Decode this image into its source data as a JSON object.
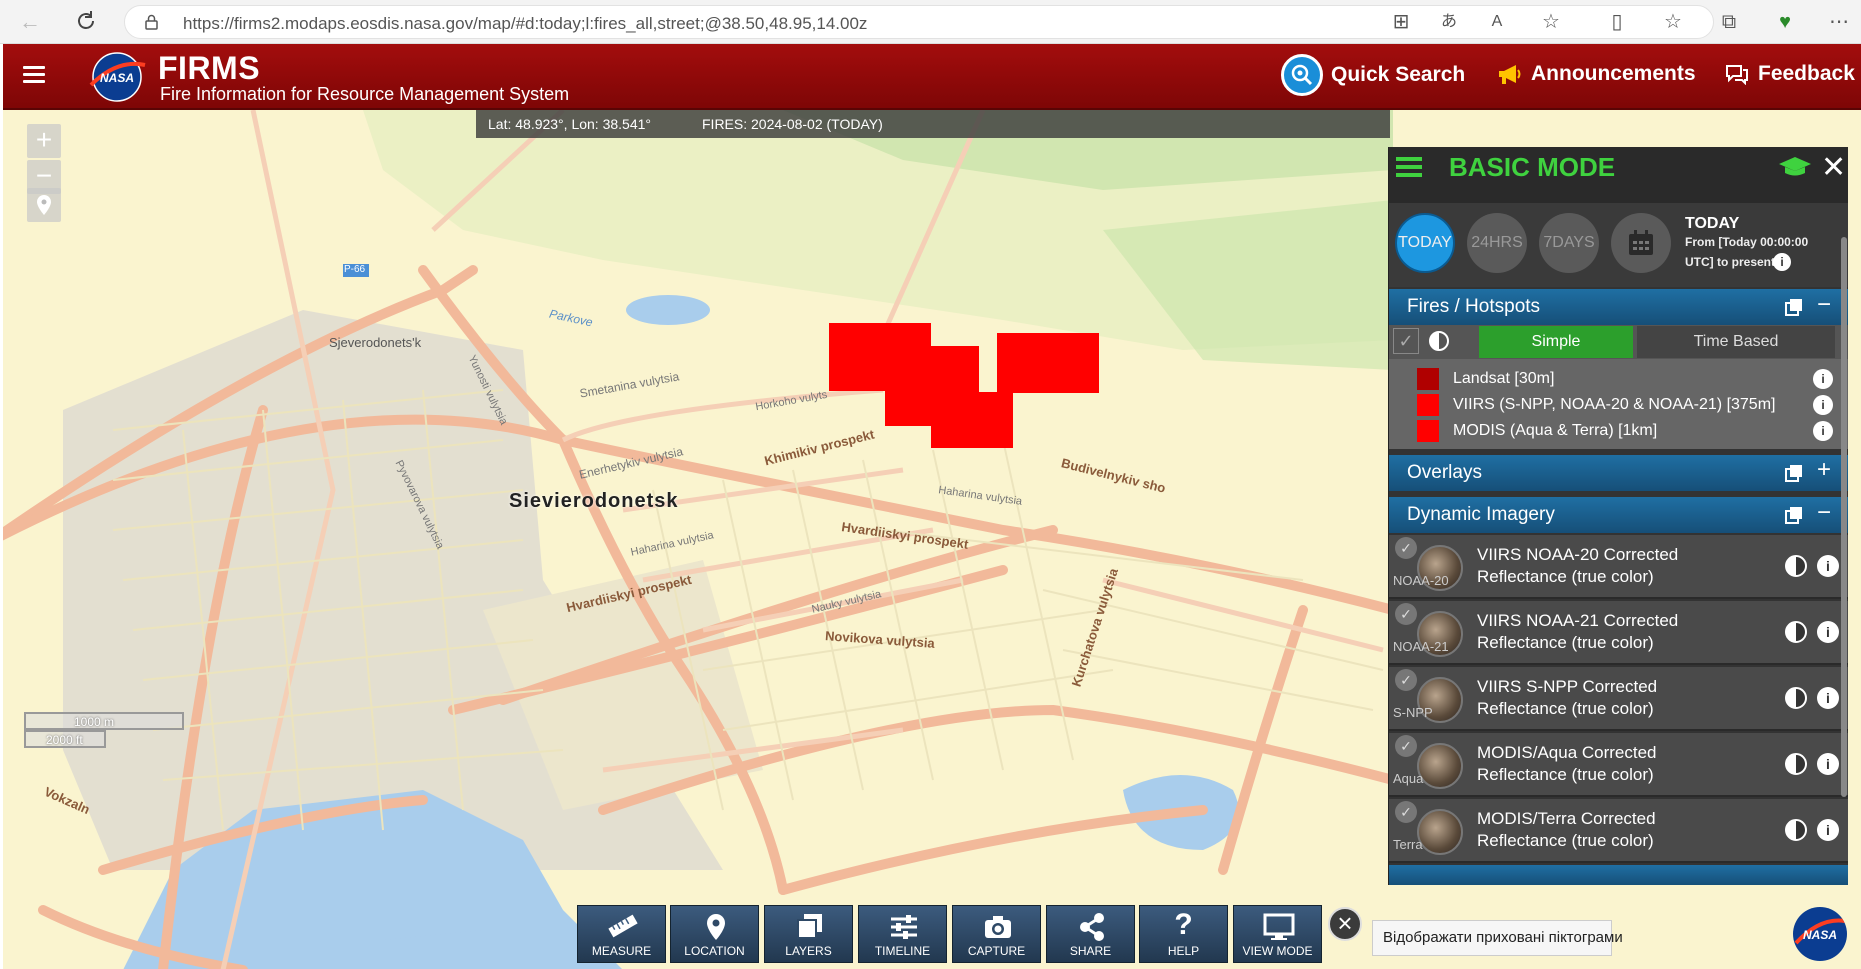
{
  "browser": {
    "url": "https://firms2.modaps.eosdis.nasa.gov/map/#d:today;l:fires_all,street;@38.50,48.95,14.00z"
  },
  "header": {
    "title": "FIRMS",
    "subtitle": "Fire Information for Resource Management System",
    "quick_search": "Quick Search",
    "announcements": "Announcements",
    "feedback": "Feedback"
  },
  "status": {
    "coords": "Lat: 48.923°, Lon: 38.541°",
    "fires": "FIRES: 2024-08-02 (TODAY)"
  },
  "map": {
    "city": "Sievierodonetsk",
    "labels": {
      "sjeverodonetsk": "Sjeverodonets'k",
      "parkove": "Parkove",
      "p66": "P-66",
      "yunosti": "Yunosti vulytsia",
      "smetanina": "Smetanina vulytsia",
      "horkoho": "Horkoho vulyts",
      "enerhetykiv": "Enerhetykiv vulytsia",
      "khimikiv": "Khimikiv prospekt",
      "budivelnykiv": "Budivelnykiv sho",
      "pyvovarova": "Pyvovarova vulytsia",
      "haharina1": "Haharina vulytsia",
      "haharina2": "Haharina vulytsia",
      "hvardiiskyi1": "Hvardiiskyi prospekt",
      "hvardiiskyi2": "Hvardiiskyi prospekt",
      "nauky": "Nauky vulytsia",
      "kurchatova": "Kurchatova vulytsia",
      "novikova": "Novikova vulytsia",
      "vokzalna": "Vokzaln"
    },
    "scale_m": "1000 m",
    "scale_ft": "2000 ft",
    "fire_color": "#ff0000"
  },
  "panel": {
    "title": "BASIC MODE",
    "time_buttons": [
      "TODAY",
      "24HRS",
      "7DAYS"
    ],
    "time_title": "TODAY",
    "time_desc_1": "From [Today 00:00:00",
    "time_desc_2": "UTC] to present",
    "fires_section": "Fires / Hotspots",
    "mode_simple": "Simple",
    "mode_time_based": "Time Based",
    "hotspots": [
      {
        "label": "Landsat [30m]",
        "color": "#b00000"
      },
      {
        "label": "VIIRS (S-NPP, NOAA-20 & NOAA-21) [375m]",
        "color": "#ff0000"
      },
      {
        "label": "MODIS (Aqua & Terra) [1km]",
        "color": "#ff0000"
      }
    ],
    "overlays_section": "Overlays",
    "dynamic_section": "Dynamic Imagery",
    "dynamic": [
      {
        "tag": "NOAA-20",
        "line1": "VIIRS NOAA-20 Corrected",
        "line2": "Reflectance (true color)"
      },
      {
        "tag": "NOAA-21",
        "line1": "VIIRS NOAA-21 Corrected",
        "line2": "Reflectance (true color)"
      },
      {
        "tag": "S-NPP",
        "line1": "VIIRS S-NPP Corrected",
        "line2": "Reflectance (true color)"
      },
      {
        "tag": "Aqua",
        "line1": "MODIS/Aqua Corrected",
        "line2": "Reflectance (true color)"
      },
      {
        "tag": "Terra",
        "line1": "MODIS/Terra Corrected",
        "line2": "Reflectance (true color)"
      }
    ]
  },
  "toolbar": {
    "tools": [
      "MEASURE",
      "LOCATION",
      "LAYERS",
      "TIMELINE",
      "CAPTURE",
      "SHARE",
      "HELP",
      "VIEW MODE"
    ],
    "tooltip": "Відображати приховані піктограми"
  }
}
